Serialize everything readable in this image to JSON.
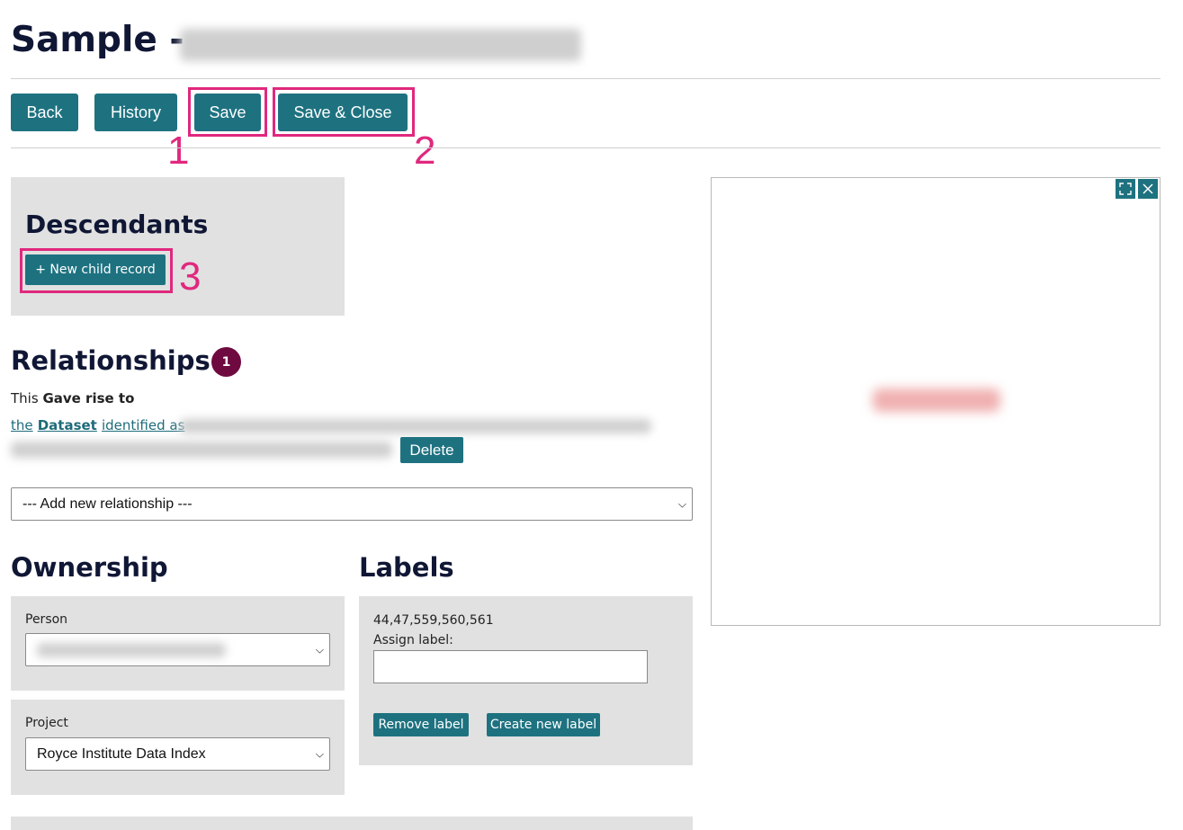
{
  "page": {
    "title": "Sample -"
  },
  "toolbar": {
    "back_label": "Back",
    "history_label": "History",
    "save_label": "Save",
    "save_close_label": "Save & Close"
  },
  "callouts": {
    "one": "1",
    "two": "2",
    "three": "3"
  },
  "descendants": {
    "heading": "Descendants",
    "new_child_label": "+ New child record"
  },
  "relationships": {
    "heading": "Relationships",
    "count": "1",
    "sentence_prefix": "This",
    "sentence_relation": "Gave rise to",
    "link_prefix": "the",
    "link_type": "Dataset",
    "link_suffix": "identified as",
    "delete_label": "Delete",
    "add_select_value": "--- Add new relationship ---"
  },
  "ownership": {
    "heading": "Ownership",
    "person_label": "Person",
    "project_label": "Project",
    "project_value": "Royce Institute Data Index"
  },
  "labels": {
    "heading": "Labels",
    "values": "44,47,559,560,561",
    "assign_label": "Assign label:",
    "assign_value": "",
    "remove_label": "Remove label",
    "create_label": "Create new label"
  },
  "icons": {
    "expand": "expand-icon",
    "close": "close-icon",
    "chevron": "chevron-down-icon"
  },
  "colors": {
    "accent": "#1e7280",
    "callout": "#e0287e",
    "badge": "#6e0a3f",
    "panel": "#e1e1e1"
  }
}
